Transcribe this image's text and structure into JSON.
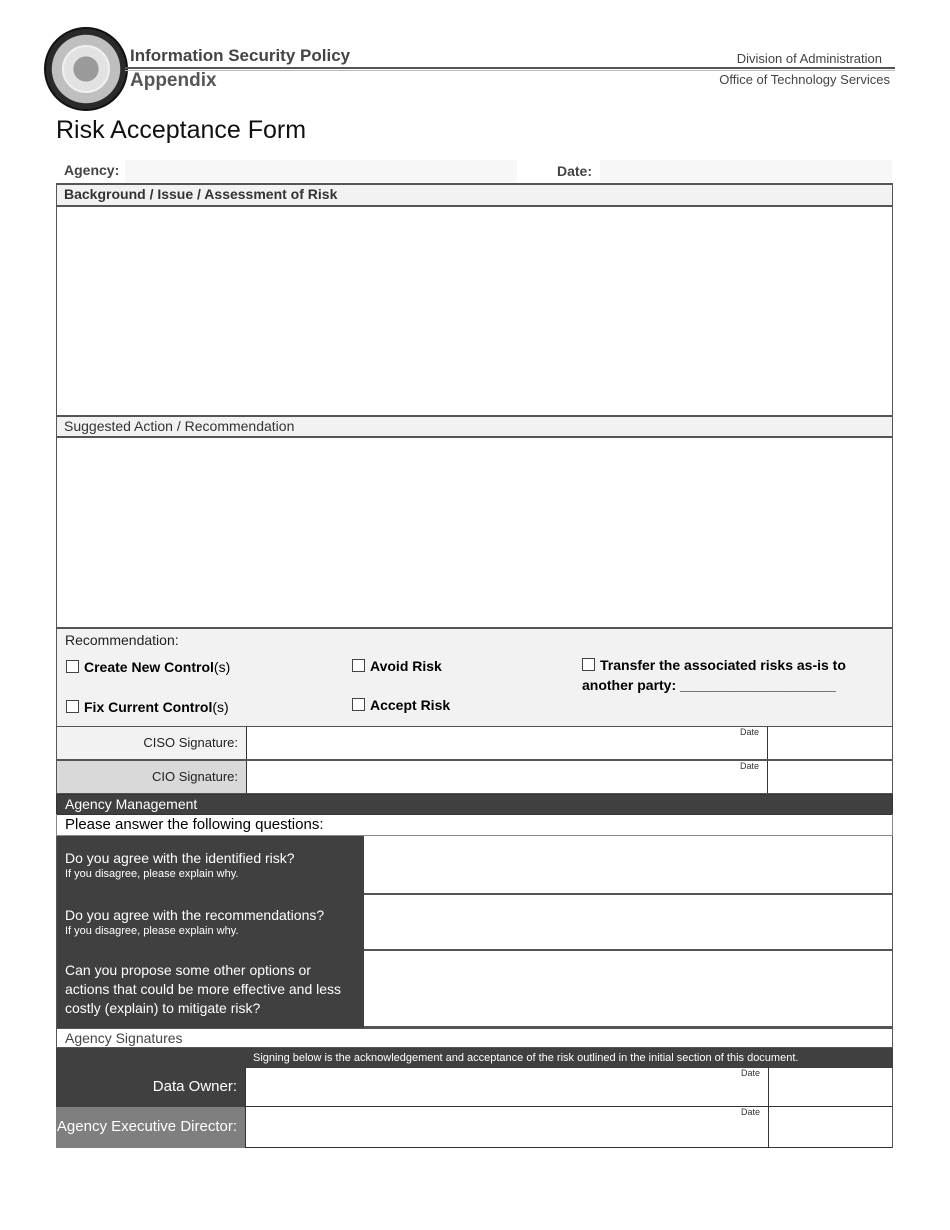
{
  "header": {
    "seal_alt": "State of Louisiana seal",
    "title": "Information Security Policy",
    "subtitle": "Appendix",
    "division": "Division of Administration",
    "office": "Office of Technology Services"
  },
  "form": {
    "title": "Risk Acceptance Form",
    "agency_label": "Agency:",
    "agency_value": "",
    "date_label": "Date:",
    "date_value": "",
    "background_header": "Background / Issue / Assessment of Risk",
    "background_value": "",
    "suggested_header": "Suggested Action / Recommendation",
    "suggested_value": ""
  },
  "recommendation": {
    "label": "Recommendation:",
    "options": [
      {
        "bold": "Create New Control",
        "rest": "(s)",
        "checked": false
      },
      {
        "bold": "Fix Current Control",
        "rest": "(s)",
        "checked": false
      },
      {
        "bold": "Avoid Risk",
        "rest": "",
        "checked": false
      },
      {
        "bold": "Accept Risk",
        "rest": "",
        "checked": false
      },
      {
        "bold": "Transfer the associated risks as-is to another party: ____________________",
        "rest": "",
        "checked": false
      }
    ]
  },
  "signatures": {
    "ciso_label": "CISO Signature:",
    "cio_label": "CIO Signature:",
    "date_label": "Date"
  },
  "management": {
    "header": "Agency Management",
    "prompt": "Please answer the following questions:",
    "questions": [
      {
        "text": "Do you agree with the identified risk?",
        "hint": "If you disagree, please explain why."
      },
      {
        "text": "Do you agree with the recommendations?",
        "hint": "If you disagree, please explain why."
      },
      {
        "text": "Can you propose some other options or actions that could be more effective and less costly (explain) to mitigate risk?",
        "hint": ""
      }
    ]
  },
  "agency_signatures": {
    "header": "Agency Signatures",
    "acknowledgement": "Signing below is the acknowledgement and acceptance of the risk outlined in the initial section of this document.",
    "data_owner_label": "Data Owner:",
    "director_label": "Agency Executive Director:",
    "date_label": "Date"
  },
  "colors": {
    "dark": "#404040",
    "light": "#f2f2f2",
    "mid": "#7f7f7f"
  }
}
